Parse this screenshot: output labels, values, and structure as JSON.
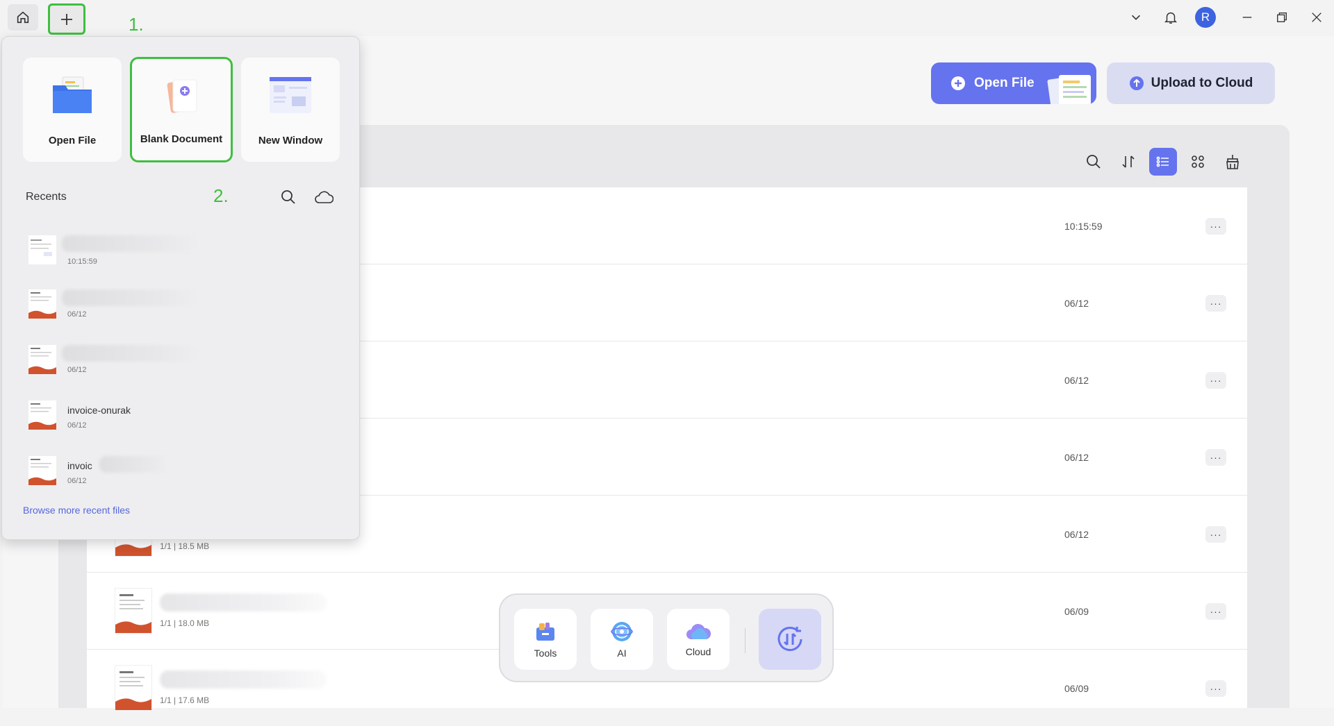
{
  "titlebar": {
    "step1": "1.",
    "avatar_initial": "R"
  },
  "header": {
    "open_file_label": "Open File",
    "upload_label": "Upload to Cloud"
  },
  "files": [
    {
      "meta": "",
      "time": "10:15:59"
    },
    {
      "meta": "",
      "time": "06/12"
    },
    {
      "meta": "",
      "time": "06/12"
    },
    {
      "meta": "",
      "time": "06/12"
    },
    {
      "meta": "1/1 | 18.5 MB",
      "time": "06/12"
    },
    {
      "meta": "1/1 | 18.0 MB",
      "time": "06/09"
    },
    {
      "meta": "1/1 | 17.6 MB",
      "time": "06/09"
    }
  ],
  "more_label": "···",
  "dock": {
    "tools": "Tools",
    "ai": "AI",
    "cloud": "Cloud"
  },
  "popup": {
    "cards": {
      "open_file": "Open File",
      "blank_document": "Blank Document",
      "new_window": "New Window"
    },
    "step2": "2.",
    "recents_title": "Recents",
    "recents": [
      {
        "name": "",
        "date": "10:15:59"
      },
      {
        "name": "",
        "date": "06/12"
      },
      {
        "name": "",
        "date": "06/12"
      },
      {
        "name": "invoice-onurak",
        "date": "06/12"
      },
      {
        "name": "invoic",
        "date": "06/12"
      }
    ],
    "browse_more": "Browse more recent files"
  },
  "colors": {
    "accent": "#6573ee",
    "highlight": "#3fbf3f",
    "avatar": "#3d63e0"
  }
}
